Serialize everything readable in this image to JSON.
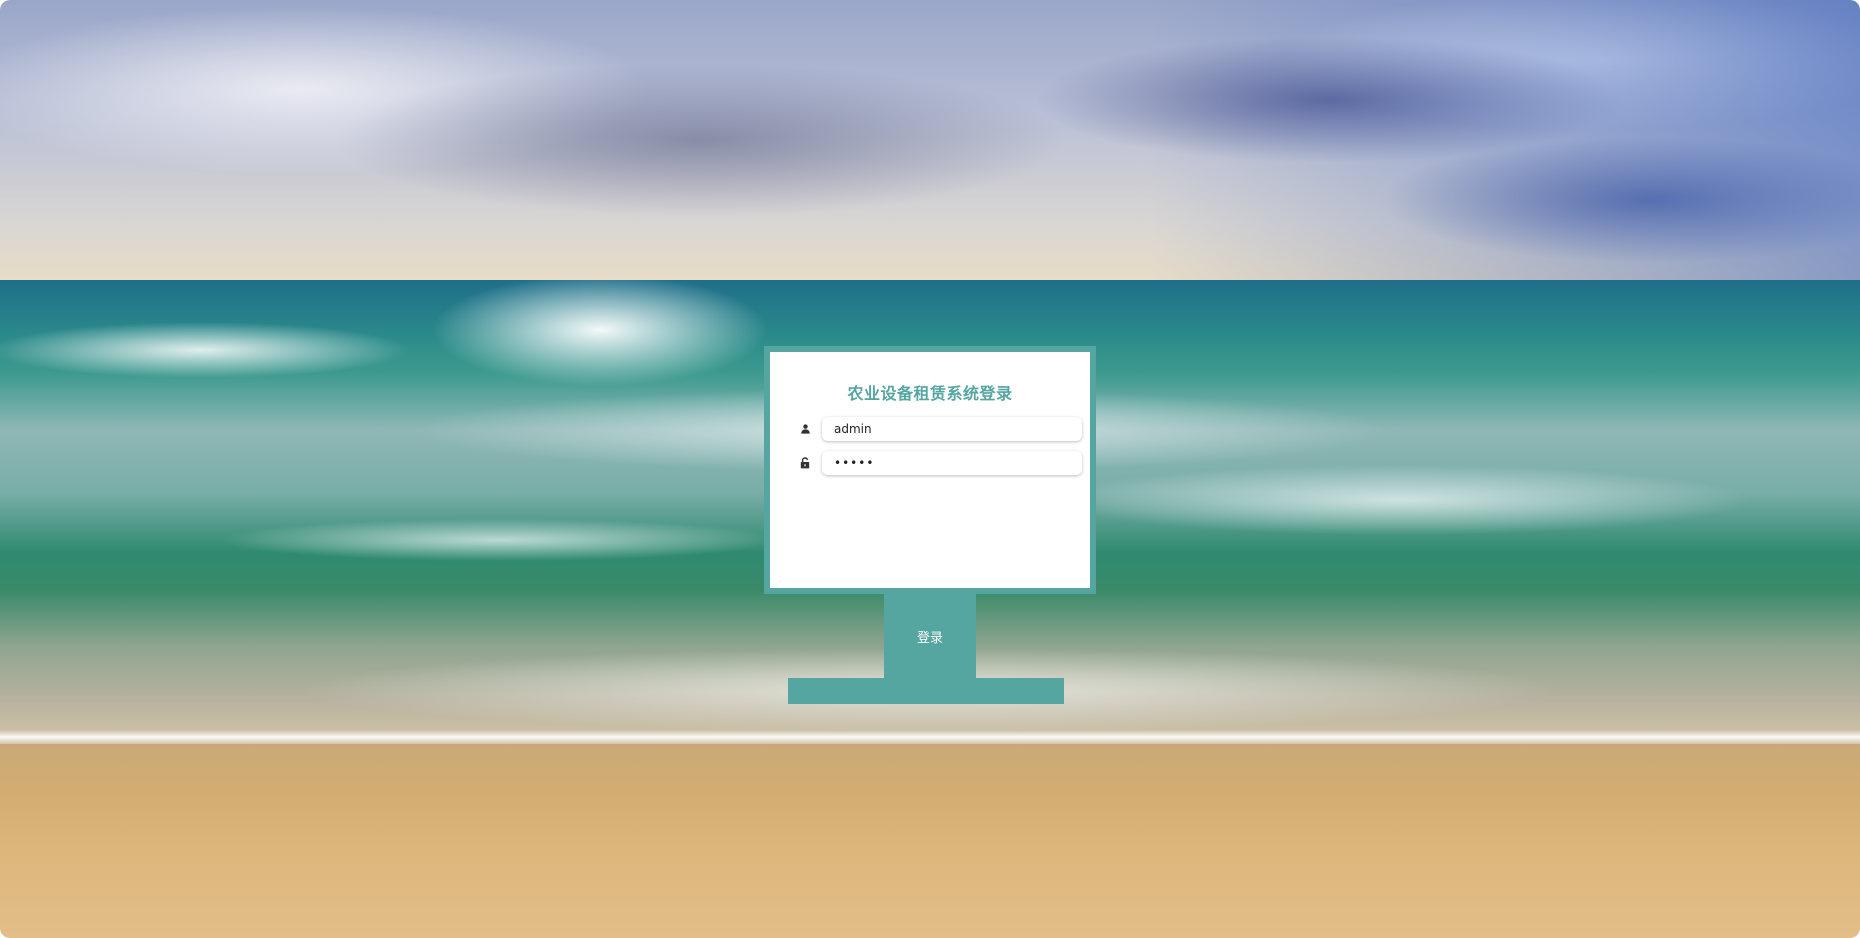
{
  "login": {
    "title": "农业设备租赁系统登录",
    "username_value": "admin",
    "password_value": "•••••",
    "submit_label": "登录"
  },
  "icons": {
    "username": "user-icon",
    "password": "lock-icon"
  },
  "colors": {
    "accent": "#55a5a1",
    "card_background": "#ffffff",
    "button_text": "#ffffff"
  }
}
